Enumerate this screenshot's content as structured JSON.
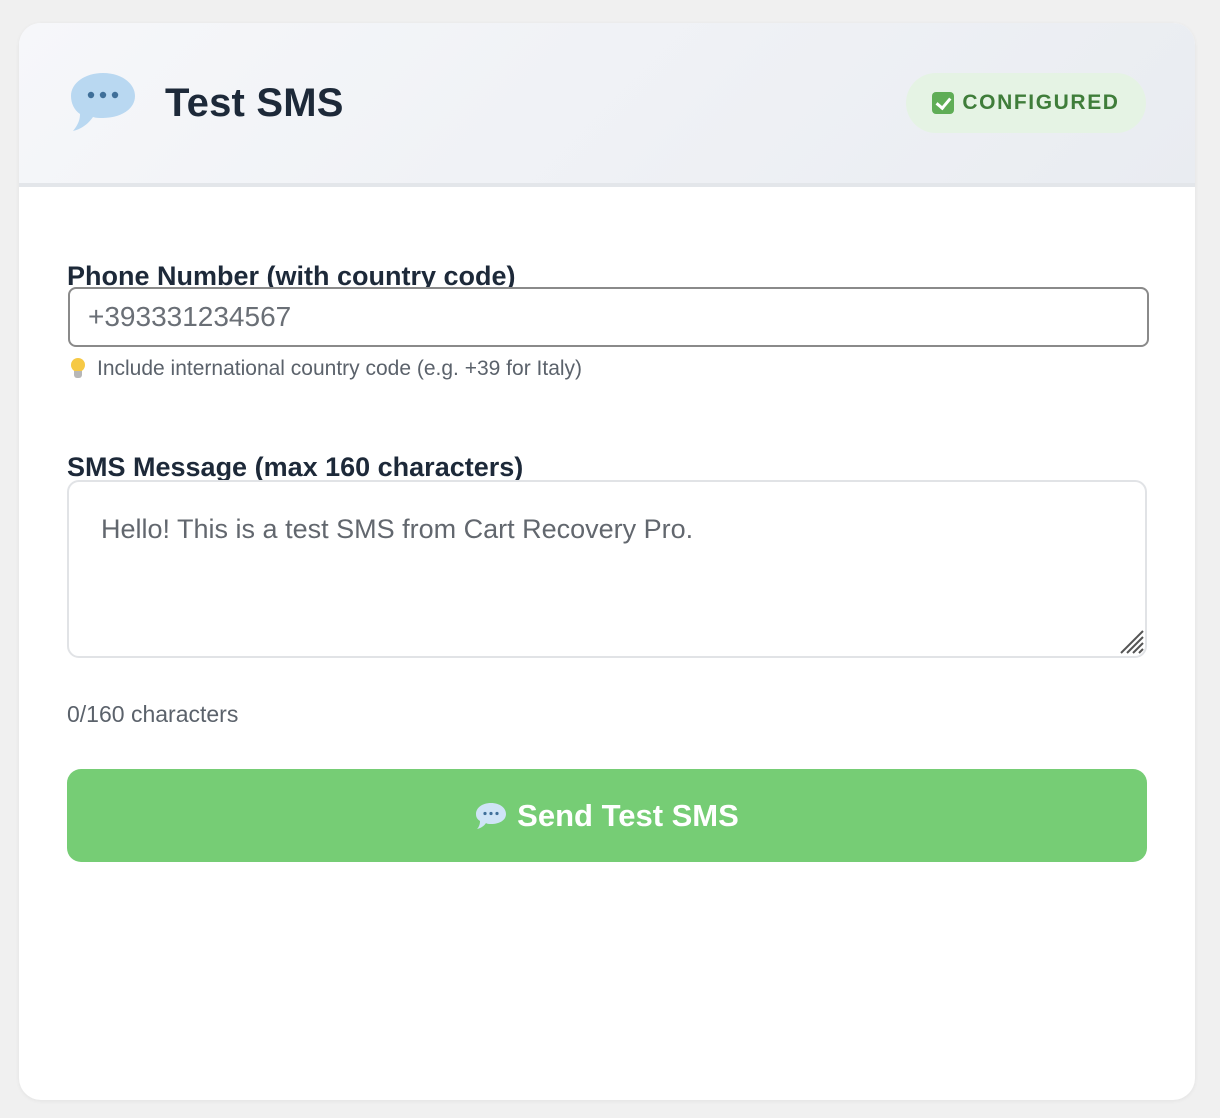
{
  "header": {
    "icon": "speech-bubble-icon",
    "title": "Test SMS",
    "status_badge": {
      "icon": "check-icon",
      "label": "CONFIGURED",
      "color": "#3f7d3a",
      "background": "#e5f3e4"
    }
  },
  "form": {
    "phone": {
      "label": "Phone Number (with country code)",
      "placeholder": "+393331234567",
      "value": "",
      "hint_icon": "lightbulb-icon",
      "hint": "Include international country code (e.g. +39 for Italy)"
    },
    "message": {
      "label": "SMS Message (max 160 characters)",
      "placeholder": "Hello! This is a test SMS from Cart Recovery Pro.",
      "value": "",
      "counter": "0/160 characters"
    },
    "send_button": {
      "icon": "speech-bubble-icon",
      "label": "Send Test SMS",
      "color": "#76cd75"
    }
  }
}
